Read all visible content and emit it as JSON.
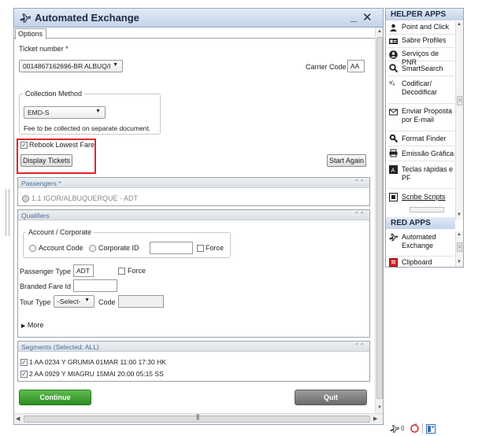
{
  "window": {
    "title": "Automated Exchange",
    "minimize": "_",
    "close": "✕"
  },
  "tabs": [
    {
      "label": "Options"
    }
  ],
  "ticket": {
    "label": "Ticket number *",
    "value": "0014867162696-BR ALBUQ/I",
    "carrier_label": "Carrier Code",
    "carrier_value": "AA"
  },
  "collection": {
    "title": "Collection Method",
    "value": "EMD-S",
    "note": "Fee to be collected on separate document."
  },
  "rebook": {
    "label": "Rebook Lowest Fare",
    "checked": true
  },
  "buttons": {
    "display_tickets": "Display Tickets",
    "start_again": "Start Again",
    "continue": "Continue",
    "quit": "Quit"
  },
  "passengers": {
    "header": "Passengers *",
    "items": [
      "1.1 IGOR/ALBUQUERQUE - ADT"
    ]
  },
  "qualifiers": {
    "header": "Qualifiers",
    "account_group": "Account / Corporate",
    "account_code": "Account Code",
    "corporate_id": "Corporate ID",
    "force": "Force",
    "passenger_type_label": "Passenger Type",
    "passenger_type_value": "ADT",
    "branded_fare_label": "Branded Fare Id",
    "tour_type_label": "Tour Type",
    "tour_type_value": "-Select-",
    "code_label": "Code",
    "more": "More"
  },
  "segments": {
    "header": "Segments (Selected: ALL)",
    "items": [
      "1 AA 0234 Y GRUMIA 01MAR 11:00 17:30 HK",
      "2 AA 0929 Y MIAGRU 15MAI 20:00 05:15 SS"
    ]
  },
  "helper_apps": {
    "title": "HELPER APPS",
    "items": [
      {
        "label": "Point and Click",
        "icon": "people-icon"
      },
      {
        "label": "Sabre Profiles",
        "icon": "id-card-icon"
      },
      {
        "label": "Serviços de PNR",
        "icon": "person-circle-icon"
      },
      {
        "label": "SmartSearch",
        "icon": "magnifier-icon"
      },
      {
        "label": "Codificar/ Decodificar",
        "icon": "translate-icon"
      },
      {
        "label": "Enviar Proposta por E-mail",
        "icon": "envelope-icon"
      },
      {
        "label": "Format Finder",
        "icon": "search-doc-icon"
      },
      {
        "label": "Emissão Gráfica",
        "icon": "printer-icon"
      },
      {
        "label": "Teclas rápidas e PF",
        "icon": "keyboard-icon"
      },
      {
        "label": "Scribe Scripts",
        "icon": "script-icon"
      }
    ]
  },
  "red_apps": {
    "title": "RED APPS",
    "items": [
      {
        "label": "Automated Exchange",
        "icon": "plane-icon"
      },
      {
        "label": "Clipboard",
        "icon": "clipboard-icon"
      }
    ]
  },
  "tray": {
    "count": "0"
  },
  "colors": {
    "highlight": "#e0262a",
    "section_header_text": "#4a6ea0",
    "continue": "#3a9a2c",
    "quit": "#808080"
  }
}
